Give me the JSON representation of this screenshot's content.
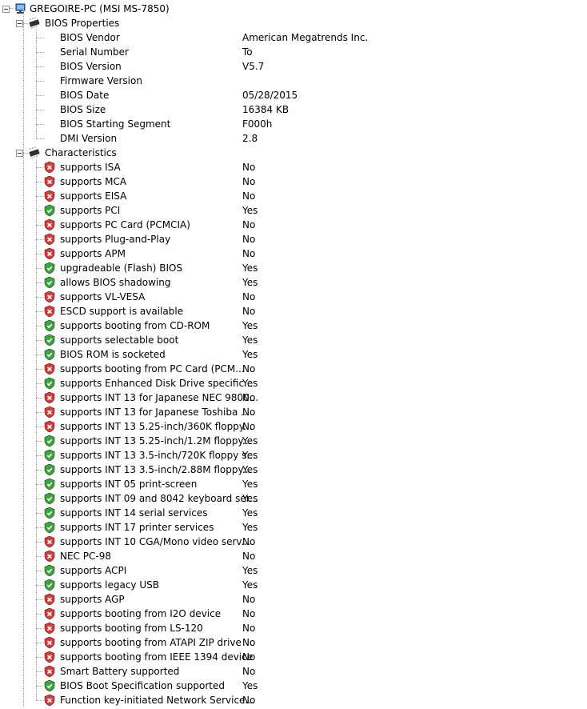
{
  "root": {
    "label": "GREGOIRE-PC (MSI MS-7850)",
    "icon": "computer-icon"
  },
  "bios_properties": {
    "label": "BIOS Properties",
    "icon": "chip-icon",
    "items": [
      {
        "label": "BIOS Vendor",
        "value": "American Megatrends Inc."
      },
      {
        "label": "Serial Number",
        "value": "To"
      },
      {
        "label": "BIOS Version",
        "value": "V5.7"
      },
      {
        "label": "Firmware Version",
        "value": ""
      },
      {
        "label": "BIOS Date",
        "value": "05/28/2015"
      },
      {
        "label": "BIOS Size",
        "value": "16384 KB"
      },
      {
        "label": "BIOS Starting Segment",
        "value": "F000h"
      },
      {
        "label": "DMI Version",
        "value": "2.8"
      }
    ]
  },
  "characteristics": {
    "label": "Characteristics",
    "icon": "chip-icon",
    "items": [
      {
        "label": "supports ISA",
        "value": "No"
      },
      {
        "label": "supports MCA",
        "value": "No"
      },
      {
        "label": "supports EISA",
        "value": "No"
      },
      {
        "label": "supports PCI",
        "value": "Yes"
      },
      {
        "label": "supports PC Card (PCMCIA)",
        "value": "No"
      },
      {
        "label": "supports Plug-and-Play",
        "value": "No"
      },
      {
        "label": "supports APM",
        "value": "No"
      },
      {
        "label": "upgradeable (Flash) BIOS",
        "value": "Yes"
      },
      {
        "label": "allows BIOS shadowing",
        "value": "Yes"
      },
      {
        "label": "supports VL-VESA",
        "value": "No"
      },
      {
        "label": "ESCD support is available",
        "value": "No"
      },
      {
        "label": "supports booting from CD-ROM",
        "value": "Yes"
      },
      {
        "label": "supports selectable boot",
        "value": "Yes"
      },
      {
        "label": "BIOS ROM is socketed",
        "value": "Yes"
      },
      {
        "label": "supports booting from PC Card (PCM...",
        "value": "No"
      },
      {
        "label": "supports Enhanced Disk Drive specific...",
        "value": "Yes"
      },
      {
        "label": "supports INT 13 for Japanese NEC 9800...",
        "value": "No"
      },
      {
        "label": "supports INT 13 for Japanese Toshiba ...",
        "value": "No"
      },
      {
        "label": "supports INT 13 5.25-inch/360K floppy...",
        "value": "No"
      },
      {
        "label": "supports INT 13 5.25-inch/1.2M floppy...",
        "value": "Yes"
      },
      {
        "label": "supports INT 13 3.5-inch/720K floppy s...",
        "value": "Yes"
      },
      {
        "label": "supports INT 13 3.5-inch/2.88M floppy...",
        "value": "Yes"
      },
      {
        "label": "supports INT 05 print-screen",
        "value": "Yes"
      },
      {
        "label": "supports INT 09 and 8042 keyboard ser...",
        "value": "Yes"
      },
      {
        "label": "supports INT 14 serial services",
        "value": "Yes"
      },
      {
        "label": "supports INT 17 printer services",
        "value": "Yes"
      },
      {
        "label": "supports INT 10 CGA/Mono video serv...",
        "value": "No"
      },
      {
        "label": "NEC PC-98",
        "value": "No"
      },
      {
        "label": "supports ACPI",
        "value": "Yes"
      },
      {
        "label": "supports legacy USB",
        "value": "Yes"
      },
      {
        "label": "supports AGP",
        "value": "No"
      },
      {
        "label": "supports booting from I2O device",
        "value": "No"
      },
      {
        "label": "supports booting from LS-120",
        "value": "No"
      },
      {
        "label": "supports booting from ATAPI ZIP drive",
        "value": "No"
      },
      {
        "label": "supports booting from IEEE 1394 device",
        "value": "No"
      },
      {
        "label": "Smart Battery supported",
        "value": "No"
      },
      {
        "label": "BIOS Boot Specification supported",
        "value": "Yes"
      },
      {
        "label": "Function key-initiated Network Service...",
        "value": "No"
      }
    ]
  },
  "icons": {
    "yes": "shield-check-icon",
    "no": "shield-x-icon"
  },
  "colors": {
    "yes": "#3aa53a",
    "no": "#d43b3b",
    "tree_lines": "#a0a0a0"
  }
}
